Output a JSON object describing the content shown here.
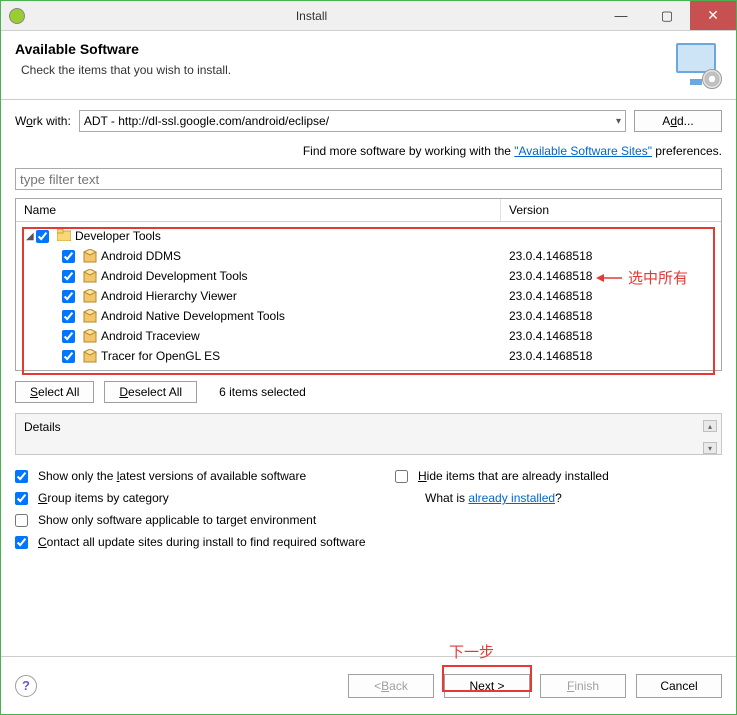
{
  "window": {
    "title": "Install"
  },
  "header": {
    "title": "Available Software",
    "subtitle": "Check the items that you wish to install."
  },
  "workwith": {
    "label_pre": "W",
    "label_u": "o",
    "label_post": "rk with:",
    "value": "ADT - http://dl-ssl.google.com/android/eclipse/",
    "add_pre": "A",
    "add_u": "d",
    "add_post": "d...",
    "more_pre": "Find more software by working with the ",
    "more_link": "\"Available Software Sites\"",
    "more_post": " preferences."
  },
  "filter": {
    "placeholder": "type filter text"
  },
  "columns": {
    "name": "Name",
    "version": "Version"
  },
  "tree": {
    "group": {
      "label": "Developer Tools",
      "checked": true
    },
    "items": [
      {
        "label": "Android DDMS",
        "version": "23.0.4.1468518",
        "checked": true
      },
      {
        "label": "Android Development Tools",
        "version": "23.0.4.1468518",
        "checked": true
      },
      {
        "label": "Android Hierarchy Viewer",
        "version": "23.0.4.1468518",
        "checked": true
      },
      {
        "label": "Android Native Development Tools",
        "version": "23.0.4.1468518",
        "checked": true
      },
      {
        "label": "Android Traceview",
        "version": "23.0.4.1468518",
        "checked": true
      },
      {
        "label": "Tracer for OpenGL ES",
        "version": "23.0.4.1468518",
        "checked": true
      }
    ]
  },
  "annotation": {
    "select_all": "选中所有",
    "next_step": "下一步"
  },
  "selection": {
    "select_all_pre": "S",
    "select_all_mid": "elect All",
    "deselect_all_pre": "D",
    "deselect_all_mid": "eselect All",
    "count_text": "6 items selected"
  },
  "details": {
    "label": "Details"
  },
  "options": {
    "show_latest": {
      "pre": "Show only the ",
      "u": "l",
      "post": "atest versions of available software",
      "checked": true
    },
    "hide_installed": {
      "pre": "",
      "u": "H",
      "post": "ide items that are already installed",
      "checked": false
    },
    "group_category": {
      "pre": "",
      "u": "G",
      "post": "roup items by category",
      "checked": true
    },
    "whatis_pre": "What is ",
    "whatis_link": "already installed",
    "whatis_post": "?",
    "applicable_env": {
      "pre": "Show only software applicable to target environment",
      "checked": false
    },
    "contact_sites": {
      "pre": "",
      "u": "C",
      "post": "ontact all update sites during install to find required software",
      "checked": true
    }
  },
  "footer": {
    "back_pre": "< ",
    "back_u": "B",
    "back_post": "ack",
    "next_pre": "",
    "next_u": "N",
    "next_post": "ext >",
    "finish_pre": "",
    "finish_u": "F",
    "finish_post": "inish",
    "cancel": "Cancel"
  }
}
